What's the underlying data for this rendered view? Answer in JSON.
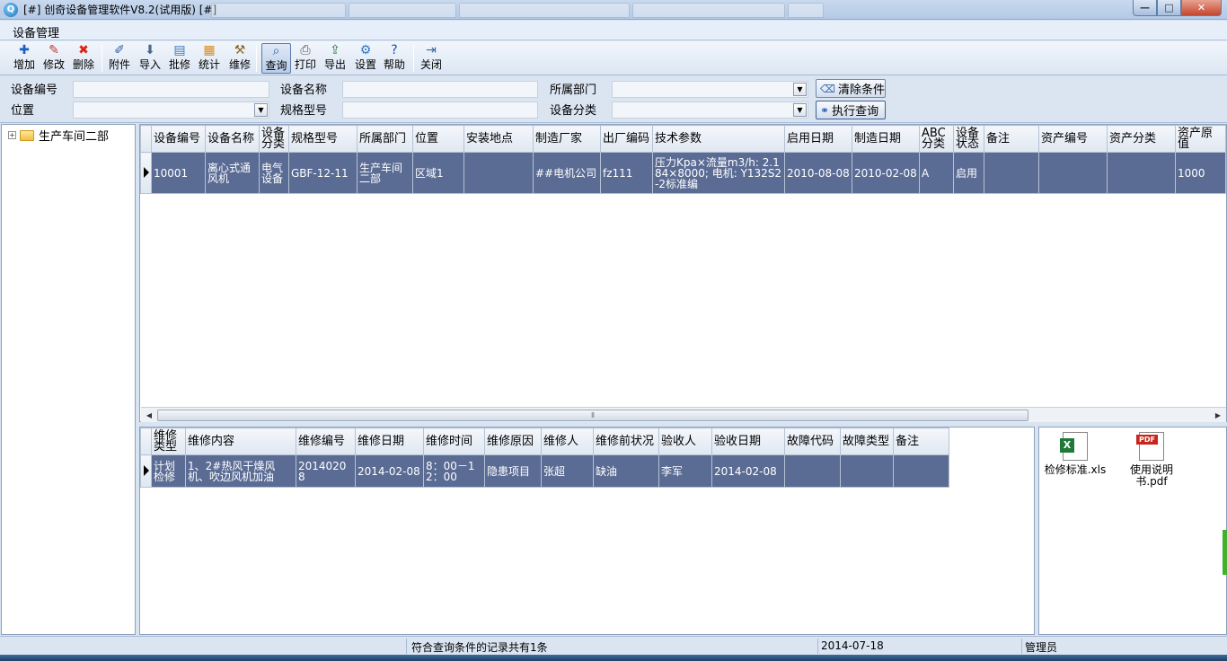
{
  "window": {
    "title": "[#] 创奇设备管理软件V8.2(试用版) [#]",
    "minimize_label": "—",
    "maximize_label": "□",
    "close_label": "✕"
  },
  "menu": {
    "item": "设备管理"
  },
  "toolbar": {
    "buttons": [
      {
        "label": "增加",
        "icon": "plus-icon",
        "glyph": "✚",
        "color": "#1a5fc9"
      },
      {
        "label": "修改",
        "icon": "pencil-icon",
        "glyph": "✎",
        "color": "#c0392b"
      },
      {
        "label": "删除",
        "icon": "delete-x-icon",
        "glyph": "✖",
        "color": "#d9261c"
      },
      {
        "label": "附件",
        "icon": "paperclip-icon",
        "glyph": "✐",
        "color": "#2a5caa"
      },
      {
        "label": "导入",
        "icon": "import-icon",
        "glyph": "⬇",
        "color": "#4a6a8a"
      },
      {
        "label": "批修",
        "icon": "document-icon",
        "glyph": "▤",
        "color": "#3a78c2"
      },
      {
        "label": "统计",
        "icon": "clipboard-icon",
        "glyph": "▦",
        "color": "#d98a1a"
      },
      {
        "label": "维修",
        "icon": "wrench-icon",
        "glyph": "⚒",
        "color": "#8a6a2a"
      },
      {
        "label": "查询",
        "icon": "magnifier-icon",
        "glyph": "⌕",
        "color": "#2a5caa"
      },
      {
        "label": "打印",
        "icon": "printer-icon",
        "glyph": "⎙",
        "color": "#555555"
      },
      {
        "label": "导出",
        "icon": "export-icon",
        "glyph": "⇪",
        "color": "#2a7a3a"
      },
      {
        "label": "设置",
        "icon": "settings-icon",
        "glyph": "⚙",
        "color": "#2a78c2"
      },
      {
        "label": "帮助",
        "icon": "help-icon",
        "glyph": "?",
        "color": "#1a4fb0"
      },
      {
        "label": "关闭",
        "icon": "exit-door-icon",
        "glyph": "⇥",
        "color": "#3a6aa8"
      }
    ]
  },
  "filter": {
    "device_code_label": "设备编号",
    "device_name_label": "设备名称",
    "department_label": "所属部门",
    "location_label": "位置",
    "model_label": "规格型号",
    "category_label": "设备分类",
    "clear_button": "清除条件",
    "search_button": "执行查询",
    "device_code_value": "",
    "device_name_value": "",
    "model_value": ""
  },
  "tree": {
    "root_label": "生产车间二部"
  },
  "devices": {
    "columns": [
      "设备编号",
      "设备名称",
      "设备分类",
      "规格型号",
      "所属部门",
      "位置",
      "安装地点",
      "制造厂家",
      "出厂编码",
      "技术参数",
      "启用日期",
      "制造日期",
      "ABC分类",
      "设备状态",
      "备注",
      "资产编号",
      "资产分类",
      "资产原值"
    ],
    "rows": [
      [
        "10001",
        "离心式通风机",
        "电气设备",
        "GBF-12-11",
        "生产车间二部",
        "区域1",
        "",
        "##电机公司",
        "fz111",
        "压力Kpa×流量m3/h: 2.184×8000; 电机: Y132S2-2标准编",
        "2010-08-08",
        "2010-02-08",
        "A",
        "启用",
        "",
        "",
        "",
        "1000"
      ]
    ]
  },
  "repairs": {
    "columns": [
      "维修类型",
      "维修内容",
      "维修编号",
      "维修日期",
      "维修时间",
      "维修原因",
      "维修人",
      "维修前状况",
      "验收人",
      "验收日期",
      "故障代码",
      "故障类型",
      "备注"
    ],
    "rows": [
      [
        "计划检修",
        "1、2#热风干燥风机、吹边风机加油",
        "20140208",
        "2014-02-08",
        "8：00－12：00",
        "隐患项目",
        "张超",
        "缺油",
        "李军",
        "2014-02-08",
        "",
        "",
        ""
      ]
    ]
  },
  "attachments": [
    {
      "name": "检修标准.xls",
      "icon": "excel-file-icon"
    },
    {
      "name": "使用说明书.pdf",
      "icon": "pdf-file-icon"
    }
  ],
  "status": {
    "message": "符合查询条件的记录共有1条",
    "date": "2014-07-18",
    "user": "管理员"
  },
  "colors": {
    "selected_row": "#5a6b94",
    "accent": "#2a5caa"
  }
}
